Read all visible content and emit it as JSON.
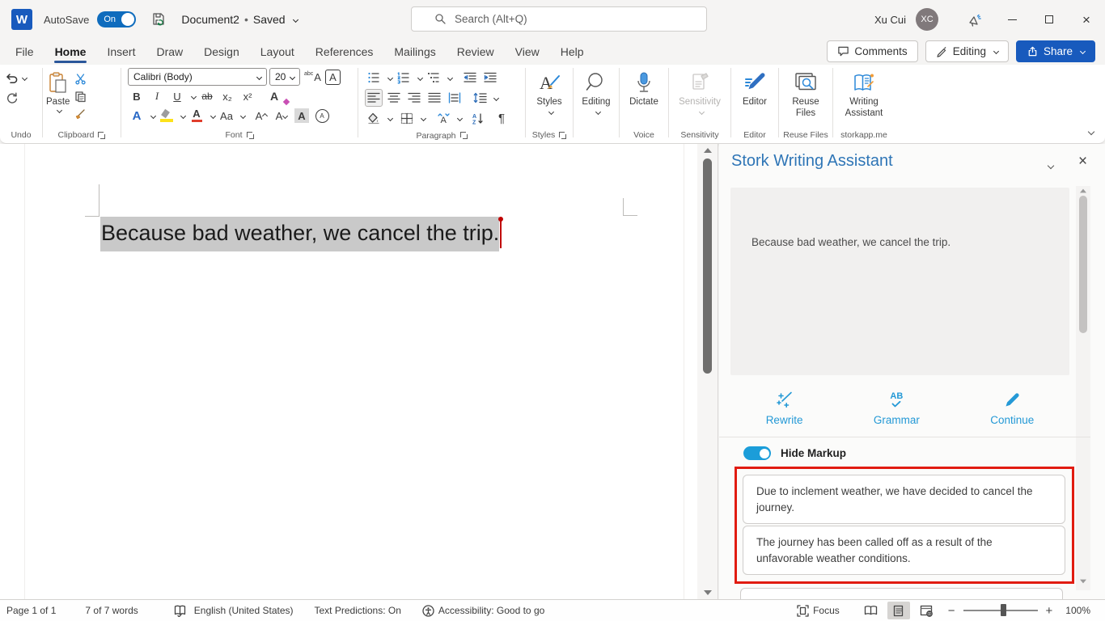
{
  "titlebar": {
    "logo_letter": "W",
    "autosave_label": "AutoSave",
    "autosave_state": "On",
    "doc_title": "Document2",
    "doc_sep": "•",
    "doc_status": "Saved",
    "search_placeholder": "Search (Alt+Q)",
    "user_name": "Xu Cui",
    "user_initials": "XC"
  },
  "tabs": [
    "File",
    "Home",
    "Insert",
    "Draw",
    "Design",
    "Layout",
    "References",
    "Mailings",
    "Review",
    "View",
    "Help"
  ],
  "active_tab": "Home",
  "top_actions": {
    "comments": "Comments",
    "editing": "Editing",
    "share": "Share"
  },
  "ribbon": {
    "paste_label": "Paste",
    "font_name": "Calibri (Body)",
    "font_size": "20",
    "glyphs": {
      "bold": "B",
      "italic": "I",
      "underline": "U",
      "strike": "ab",
      "subscript": "x₂",
      "superscript": "x²",
      "clear": "A",
      "effects": "A",
      "fontcolor": "A",
      "case": "Aa",
      "grow": "A",
      "shrink": "A",
      "shading": "A",
      "border": "A",
      "phonetic_small": "abc",
      "phonetic_big": "A",
      "pilcrow": "¶",
      "sort": "AZ",
      "enclose": "A"
    },
    "big_buttons": {
      "styles": "Styles",
      "editing": "Editing",
      "dictate": "Dictate",
      "sensitivity": "Sensitivity",
      "editor": "Editor",
      "reuse_files": "Reuse Files",
      "writing_assistant": "Writing Assistant"
    },
    "group_labels": {
      "undo": "Undo",
      "clipboard": "Clipboard",
      "font": "Font",
      "paragraph": "Paragraph",
      "styles": "Styles",
      "voice": "Voice",
      "sensitivity": "Sensitivity",
      "editor": "Editor",
      "reuse_files": "Reuse Files",
      "storkapp": "storkapp.me"
    }
  },
  "document": {
    "text": "Because bad weather, we cancel the trip."
  },
  "panel": {
    "title": "Stork Writing Assistant",
    "source_text": "Because bad weather, we cancel the trip.",
    "actions": [
      {
        "label": "Rewrite"
      },
      {
        "label": "Grammar",
        "glyph": "AB"
      },
      {
        "label": "Continue"
      }
    ],
    "toggle_label": "Hide Markup",
    "suggestions": [
      "Due to inclement weather, we have decided to cancel the journey.",
      "The journey has been called off as a result of the unfavorable weather conditions."
    ]
  },
  "statusbar": {
    "page": "Page 1 of 1",
    "words": "7 of 7 words",
    "language": "English (United States)",
    "predictions": "Text Predictions: On",
    "accessibility": "Accessibility: Good to go",
    "focus": "Focus",
    "zoom_level": "100%"
  },
  "colors": {
    "accent_blue": "#185abd",
    "panel_title_blue": "#2e75b6",
    "action_blue": "#2499d6",
    "alert_red": "#e11b11",
    "selection_gray": "#c9c9c9"
  }
}
